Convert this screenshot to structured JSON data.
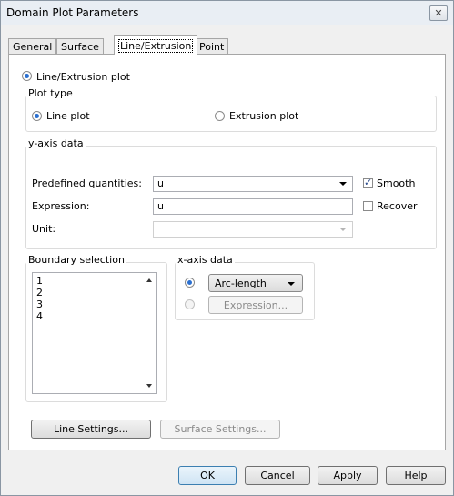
{
  "window": {
    "title": "Domain Plot Parameters",
    "close_label": "✕"
  },
  "tabs": [
    {
      "label": "General"
    },
    {
      "label": "Surface"
    },
    {
      "label": "Line/Extrusion"
    },
    {
      "label": "Point"
    }
  ],
  "line_extrusion": {
    "enable_label": "Line/Extrusion plot",
    "plot_type": {
      "title": "Plot type",
      "line_label": "Line plot",
      "extrusion_label": "Extrusion plot",
      "selected": "Line plot"
    },
    "y_axis": {
      "title": "y-axis data",
      "predefined_label": "Predefined quantities:",
      "predefined_value": "u",
      "smooth_label": "Smooth",
      "smooth_checked": true,
      "expression_label": "Expression:",
      "expression_value": "u",
      "recover_label": "Recover",
      "recover_checked": false,
      "unit_label": "Unit:",
      "unit_value": ""
    },
    "boundary": {
      "title": "Boundary selection",
      "items": [
        "1",
        "2",
        "3",
        "4"
      ]
    },
    "x_axis": {
      "title": "x-axis data",
      "arc_length_label": "Arc-length",
      "expression_button": "Expression...",
      "selected": "Arc-length"
    },
    "line_settings_button": "Line Settings...",
    "surface_settings_button": "Surface Settings..."
  },
  "footer": {
    "ok": "OK",
    "cancel": "Cancel",
    "apply": "Apply",
    "help": "Help"
  }
}
